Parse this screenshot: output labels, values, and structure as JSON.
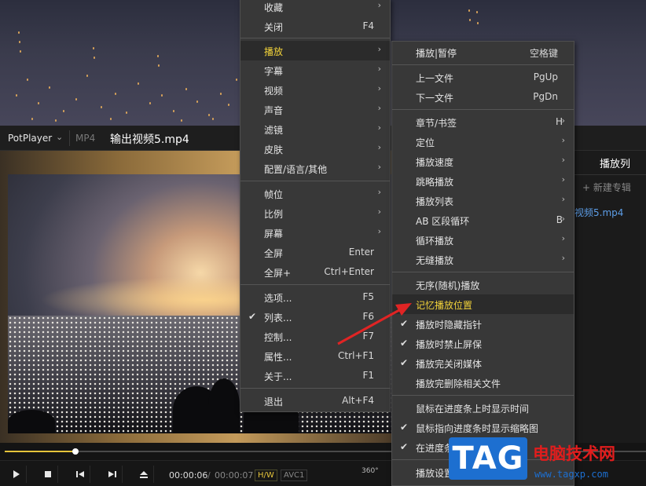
{
  "player": {
    "brand": "PotPlayer",
    "format": "MP4",
    "filename": "输出视频5.mp4",
    "side_tab": "播放列",
    "side_new_album": "+ 新建专辑",
    "side_file": "视频5.mp4",
    "time_current": "00:00:06",
    "time_separator": "/",
    "time_total": "00:00:07",
    "hw_badge": "H/W",
    "codec_badge": "AVC1",
    "vr_label": "360°",
    "progress_fraction": 0.11,
    "accent_color": "#e5c43a"
  },
  "menu_main": {
    "items": [
      {
        "label": "收藏",
        "shortcut": "",
        "submenu": true,
        "checked": false
      },
      {
        "label": "关闭",
        "shortcut": "F4",
        "submenu": false,
        "checked": false
      },
      {
        "label": "播放",
        "shortcut": "",
        "submenu": true,
        "checked": false,
        "highlighted": true
      },
      {
        "label": "字幕",
        "shortcut": "",
        "submenu": true,
        "checked": false
      },
      {
        "label": "视频",
        "shortcut": "",
        "submenu": true,
        "checked": false
      },
      {
        "label": "声音",
        "shortcut": "",
        "submenu": true,
        "checked": false
      },
      {
        "label": "滤镜",
        "shortcut": "",
        "submenu": true,
        "checked": false
      },
      {
        "label": "皮肤",
        "shortcut": "",
        "submenu": true,
        "checked": false
      },
      {
        "label": "配置/语言/其他",
        "shortcut": "",
        "submenu": true,
        "checked": false
      },
      {
        "label": "帧位",
        "shortcut": "",
        "submenu": true,
        "checked": false
      },
      {
        "label": "比例",
        "shortcut": "",
        "submenu": true,
        "checked": false
      },
      {
        "label": "屏幕",
        "shortcut": "",
        "submenu": true,
        "checked": false
      },
      {
        "label": "全屏",
        "shortcut": "Enter",
        "submenu": false,
        "checked": false
      },
      {
        "label": "全屏+",
        "shortcut": "Ctrl+Enter",
        "submenu": false,
        "checked": false
      },
      {
        "label": "选项...",
        "shortcut": "F5",
        "submenu": false,
        "checked": false
      },
      {
        "label": "列表...",
        "shortcut": "F6",
        "submenu": false,
        "checked": true
      },
      {
        "label": "控制...",
        "shortcut": "F7",
        "submenu": false,
        "checked": false
      },
      {
        "label": "属性...",
        "shortcut": "Ctrl+F1",
        "submenu": false,
        "checked": false
      },
      {
        "label": "关于...",
        "shortcut": "F1",
        "submenu": false,
        "checked": false
      },
      {
        "label": "退出",
        "shortcut": "Alt+F4",
        "submenu": false,
        "checked": false
      }
    ]
  },
  "menu_play": {
    "items": [
      {
        "label": "播放|暂停",
        "shortcut": "空格键",
        "submenu": false,
        "checked": false
      },
      {
        "label": "上一文件",
        "shortcut": "PgUp",
        "submenu": false,
        "checked": false
      },
      {
        "label": "下一文件",
        "shortcut": "PgDn",
        "submenu": false,
        "checked": false
      },
      {
        "label": "章节/书签",
        "shortcut": "H",
        "submenu": true,
        "checked": false
      },
      {
        "label": "定位",
        "shortcut": "",
        "submenu": true,
        "checked": false
      },
      {
        "label": "播放速度",
        "shortcut": "",
        "submenu": true,
        "checked": false
      },
      {
        "label": "跳略播放",
        "shortcut": "",
        "submenu": true,
        "checked": false
      },
      {
        "label": "播放列表",
        "shortcut": "",
        "submenu": true,
        "checked": false
      },
      {
        "label": "AB 区段循环",
        "shortcut": "B",
        "submenu": true,
        "checked": false
      },
      {
        "label": "循环播放",
        "shortcut": "",
        "submenu": true,
        "checked": false
      },
      {
        "label": "无缝播放",
        "shortcut": "",
        "submenu": true,
        "checked": false
      },
      {
        "label": "无序(随机)播放",
        "shortcut": "",
        "submenu": false,
        "checked": false
      },
      {
        "label": "记忆播放位置",
        "shortcut": "",
        "submenu": false,
        "checked": false,
        "highlighted": true
      },
      {
        "label": "播放时隐藏指针",
        "shortcut": "",
        "submenu": false,
        "checked": true
      },
      {
        "label": "播放时禁止屏保",
        "shortcut": "",
        "submenu": false,
        "checked": true
      },
      {
        "label": "播放完关闭媒体",
        "shortcut": "",
        "submenu": false,
        "checked": true
      },
      {
        "label": "播放完删除相关文件",
        "shortcut": "",
        "submenu": false,
        "checked": false
      },
      {
        "label": "鼠标在进度条上时显示时间",
        "shortcut": "",
        "submenu": false,
        "checked": false
      },
      {
        "label": "鼠标指向进度条时显示缩略图",
        "shortcut": "",
        "submenu": false,
        "checked": true
      },
      {
        "label": "在进度条",
        "shortcut": "",
        "submenu": false,
        "checked": true
      },
      {
        "label": "播放设置",
        "shortcut": "",
        "submenu": false,
        "checked": false
      }
    ]
  },
  "watermark": {
    "tag": "TAG",
    "site_name": "电脑技术网",
    "url": "www.tagxp.com",
    "tag_color": "#1d6fd0",
    "name_color": "#e11d1d"
  },
  "annotation": {
    "arrow_color": "#e02424"
  }
}
